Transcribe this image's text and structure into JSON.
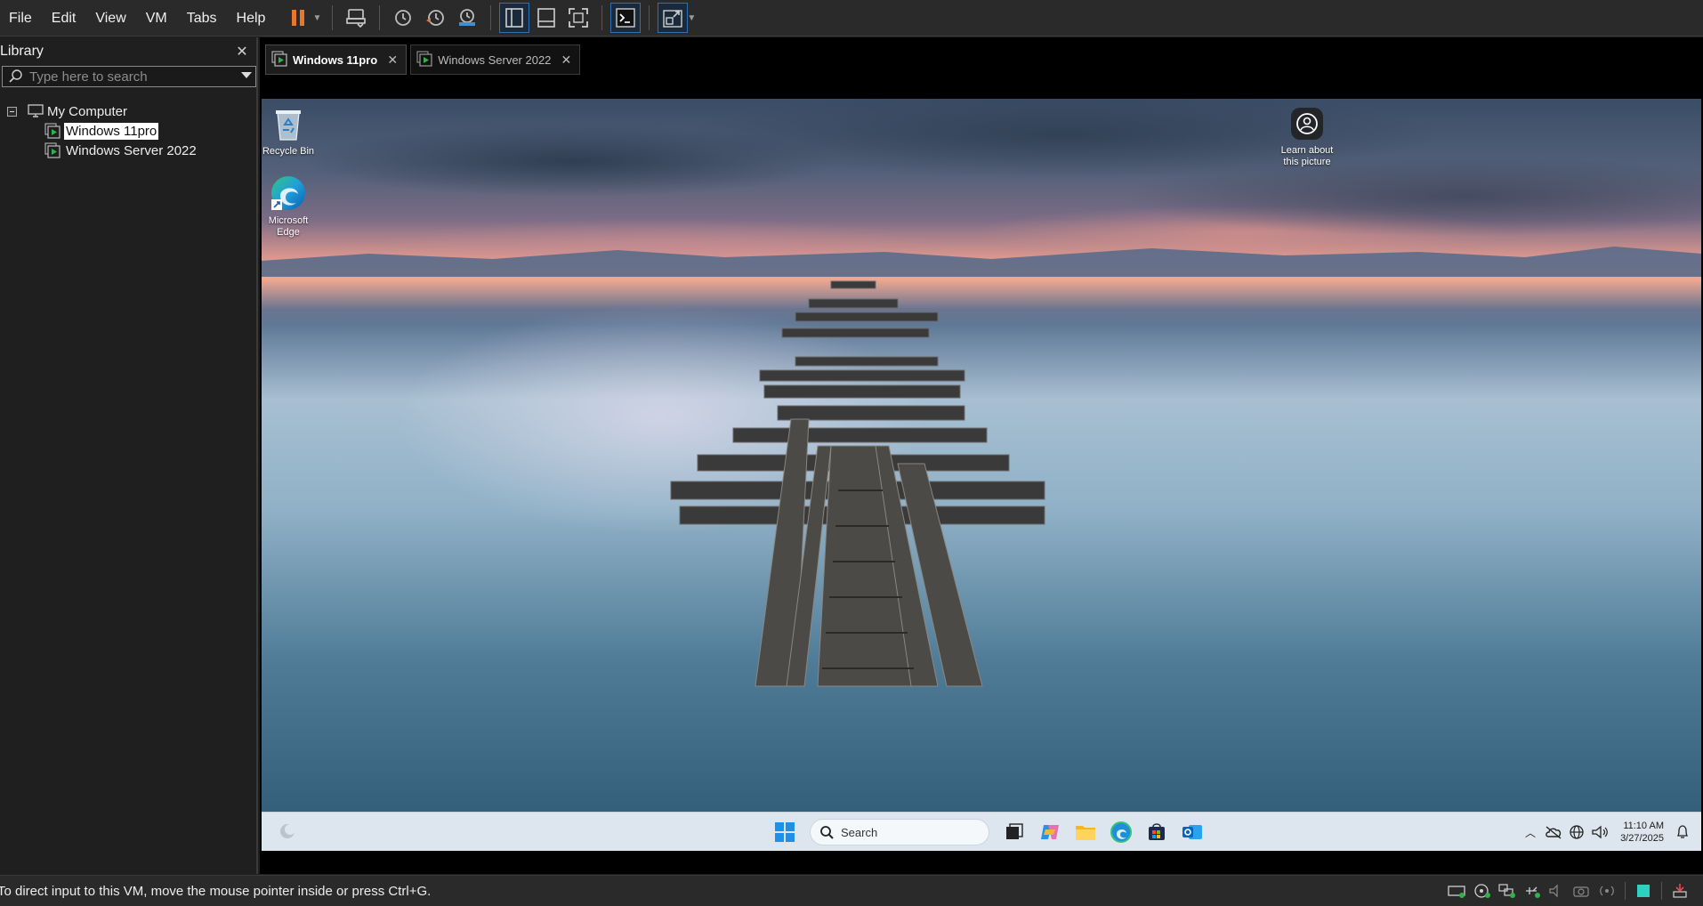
{
  "menu": {
    "items": [
      "File",
      "Edit",
      "View",
      "VM",
      "Tabs",
      "Help"
    ]
  },
  "toolbar": {
    "accent": "#e8762b",
    "icons": [
      "pause-icon",
      "send-ctrl-alt-del-icon",
      "snapshot-icon",
      "revert-snapshot-icon",
      "snapshot-manager-icon",
      "show-library-icon",
      "thumbnail-bar-icon",
      "full-screen-icon",
      "console-view-icon",
      "stretch-guest-icon"
    ]
  },
  "library": {
    "title": "Library",
    "search_placeholder": "Type here to search",
    "root": "My Computer",
    "vms": [
      "Windows 11pro",
      "Windows Server 2022"
    ],
    "selected": "Windows 11pro"
  },
  "tabs": [
    {
      "label": "Windows 11pro",
      "active": true
    },
    {
      "label": "Windows Server 2022",
      "active": false
    }
  ],
  "guest": {
    "desktop_icons": {
      "recycle_bin": "Recycle Bin",
      "edge_line1": "Microsoft",
      "edge_line2": "Edge"
    },
    "learn_line1": "Learn about",
    "learn_line2": "this picture",
    "taskbar": {
      "search_label": "Search",
      "time": "11:10 AM",
      "date": "3/27/2025"
    }
  },
  "status": {
    "message": "To direct input to this VM, move the mouse pointer inside or press Ctrl+G."
  }
}
